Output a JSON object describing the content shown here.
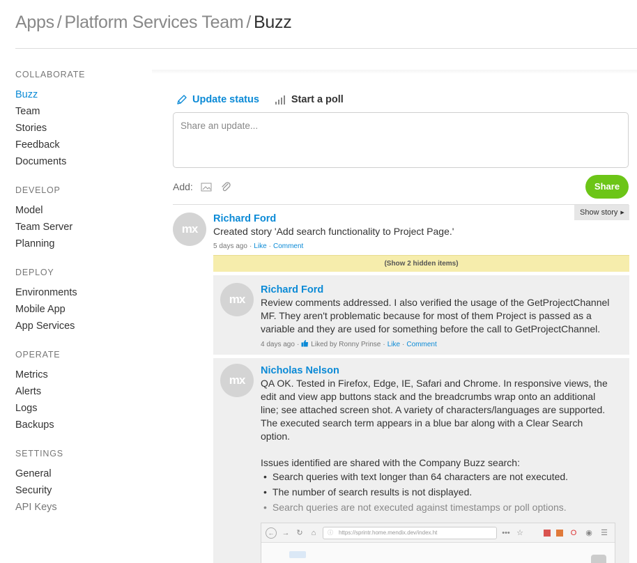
{
  "breadcrumb": {
    "apps": "Apps",
    "sep": "/",
    "team": "Platform Services Team",
    "current": "Buzz"
  },
  "sidebar": {
    "sections": [
      {
        "heading": "COLLABORATE",
        "items": [
          "Buzz",
          "Team",
          "Stories",
          "Feedback",
          "Documents"
        ]
      },
      {
        "heading": "DEVELOP",
        "items": [
          "Model",
          "Team Server",
          "Planning"
        ]
      },
      {
        "heading": "DEPLOY",
        "items": [
          "Environments",
          "Mobile App",
          "App Services"
        ]
      },
      {
        "heading": "OPERATE",
        "items": [
          "Metrics",
          "Alerts",
          "Logs",
          "Backups"
        ]
      },
      {
        "heading": "SETTINGS",
        "items": [
          "General",
          "Security",
          "API Keys"
        ]
      }
    ]
  },
  "composer": {
    "tab_update": "Update status",
    "tab_poll": "Start a poll",
    "placeholder": "Share an update...",
    "add_label": "Add:",
    "share_label": "Share"
  },
  "avatar_text": "mx",
  "colors": {
    "accent": "#0b8ad6",
    "share": "#6cc517",
    "highlight": "#f6edac"
  },
  "post": {
    "author": "Richard Ford",
    "text": "Created story 'Add search functionality to Project Page.'",
    "time": "5 days ago",
    "dash": "·",
    "like": "Like",
    "comment": "Comment",
    "show_story": "Show story",
    "hidden_items": "(Show 2 hidden items)"
  },
  "replies": [
    {
      "author": "Richard Ford",
      "lines": [
        "Review comments addressed. I also verified the usage of the GetProjectChannel",
        "MF. They aren't problematic because for most of them Project is passed as a",
        "variable and they are used for something before the call to GetProjectChannel."
      ],
      "time": "4 days ago",
      "liked_by": "Liked by Ronny Prinse",
      "like": "Like",
      "comment": "Comment"
    },
    {
      "author": "Nicholas Nelson",
      "lines": [
        "QA OK. Tested in Firefox, Edge, IE, Safari and Chrome. In responsive views, the",
        "edit and view app buttons stack and the breadcrumbs wrap onto an additional",
        "line; see attached screen shot. A variety of characters/languages are supported.",
        "The executed search term appears in a blue bar along with a Clear Search",
        "option."
      ],
      "issues_intro": "Issues identified are shared with the Company Buzz search:",
      "issues": [
        "Search queries with text longer than 64 characters are not executed.",
        "The number of search results is not displayed.",
        "Search queries are not executed against timestamps or poll options."
      ]
    }
  ],
  "attachment": {
    "url": "https://sprintr.home.mendix.dev/index.ht",
    "dots": "•••"
  }
}
